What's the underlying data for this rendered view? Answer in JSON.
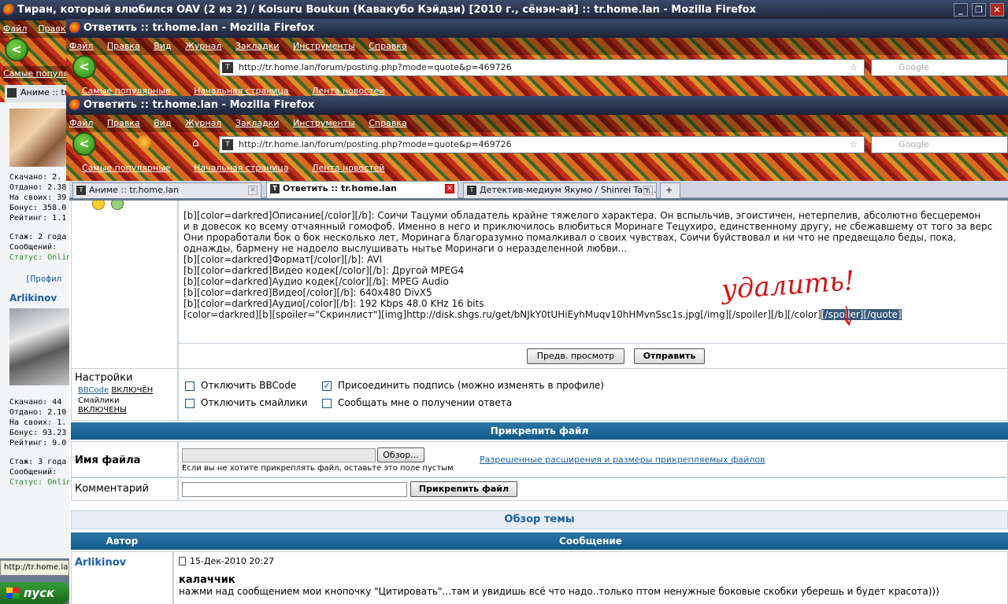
{
  "window_back": {
    "title": "Тиран, который влюбился OAV (2 из 2) / Koisuru Boukun (Кавакубо Кэйдзи) [2010 г., сёнэн-ай] :: tr.home.lan - Mozilla Firefox",
    "menu": [
      "Файл",
      "Правка"
    ],
    "bookmark": "Самые популярные",
    "tab": "Аниме :: tr",
    "status_url": "http://tr.home.la"
  },
  "window_mid": {
    "title": "Ответить :: tr.home.lan - Mozilla Firefox",
    "menu": [
      "Файл",
      "Правка",
      "Вид",
      "Журнал",
      "Закладки",
      "Инструменты",
      "Справка"
    ],
    "url": "http://tr.home.lan/forum/posting.php?mode=quote&p=469726",
    "search_placeholder": "Google",
    "bookmarks": [
      "Самые популярные",
      "Начальная страница",
      "Лента новостей"
    ]
  },
  "window_front": {
    "title": "Ответить :: tr.home.lan - Mozilla Firefox",
    "menu": [
      "Файл",
      "Правка",
      "Вид",
      "Журнал",
      "Закладки",
      "Инструменты",
      "Справка"
    ],
    "url": "http://tr.home.lan/forum/posting.php?mode=quote&p=469726",
    "search_placeholder": "Google",
    "bookmarks": [
      "Самые популярные",
      "Начальная страница",
      "Лента новостей"
    ],
    "tabs": [
      "Аниме :: tr.home.lan",
      "Ответить :: tr.home.lan",
      "Детектив-медиум Якумо / Shinrei Tan..."
    ]
  },
  "left_panel": {
    "user1_stats": [
      "Скачано: 2.",
      "Отдано: 2.38",
      "На своих: 39",
      "Бонус: 358.0",
      "Рейтинг: 1.1"
    ],
    "user1_info": [
      "Стаж: 2 года",
      "Сообщений:",
      "Статус: Onlin"
    ],
    "profile_link": "[Профил",
    "user2_name": "Arlikinov",
    "user2_stats": [
      "Скачано: 44",
      "Отдано: 2.10",
      "На своих: 1.",
      "Бонус: 93.23",
      "Рейтинг: 9.0"
    ],
    "user2_info": [
      "Стаж: 3 года",
      "Сообщений:",
      "Статус: Onlin"
    ]
  },
  "editor": {
    "lines": [
      "[b][color=darkred]Описание[/color][/b]: Соичи Тацуми обладатель крайне тяжелого характера. Он вспыльчив, эгоистичен, нетерпелив, абсолютно бесцеремон",
      "и в довесок ко всему отчаянный гомофоб. Именно в него и приключилось влюбиться Моринаге Тецухиро, единственному другу, не сбежавшему от того за верс",
      "Они проработали бок о бок несколько лет, Моринага благоразумно помалкивал о своих чувствах, Соичи буйствовал и ни что не предвещало беды, пока,",
      "однажды, бармену не надоело выслушивать нытье Моринаги о неразделенной любви...",
      "",
      "[b][color=darkred]Формат[/color][/b]: AVI",
      "[b][color=darkred]Видео кодек[/color][/b]: Другой MPEG4",
      "[b][color=darkred]Аудио кодек[/color][/b]: MPEG Audio",
      "[b][color=darkred]Видео[/color][/b]: 640x480 DivX5",
      "[b][color=darkred]Аудио[/color][/b]: 192 Kbps 48.0 KHz 16 bits",
      ""
    ],
    "last_line_plain": "[color=darkred][b][spoiler=\"Скринлист\"][img]http://disk.shgs.ru/get/bNJkY0tUHiEyhMuqv10hHMvnSsc1s.jpg[/img][/spoiler][/b][/color]",
    "last_line_selected": "[/spoiler][/quote]",
    "annotation": "удалить!",
    "preview_button": "Предв. просмотр",
    "submit_button": "Отправить"
  },
  "settings": {
    "title": "Настройки",
    "bbcode_label": "BBCode",
    "bbcode_state": "ВКЛЮЧЁН",
    "smilies_label": "Смайлики",
    "smilies_state": "ВКЛЮЧЕНЫ",
    "opt_disable_bbcode": "Отключить BBCode",
    "opt_disable_smilies": "Отключить смайлики",
    "opt_attach_sig": "Присоединить подпись (можно изменять в профиле)",
    "opt_notify": "Сообщать мне о получении ответа",
    "attach_sig_checked": true
  },
  "attach": {
    "header": "Прикрепить файл",
    "filename_label": "Имя файла",
    "browse_button": "Обзор...",
    "hint": "Если вы не хотите прикреплять файл, оставьте это поле пустым",
    "extensions_link": "Разрешенные расширения и размеры прикрепляемых файлов",
    "comment_label": "Комментарий",
    "attach_button": "Прикрепить файл"
  },
  "review": {
    "header": "Обзор темы",
    "col_author": "Автор",
    "col_message": "Сообщение",
    "author": "Arlikinov",
    "date": "15-Дек-2010 20:27",
    "msg_title": "калаччик",
    "msg_body": "нажми над сообщением мои кнопочку \"Цитировать\"...там и увидишь всё что надо..только птом ненужные боковые скобки уберешь и будет красота)))"
  },
  "taskbar": {
    "start": "пуск"
  }
}
